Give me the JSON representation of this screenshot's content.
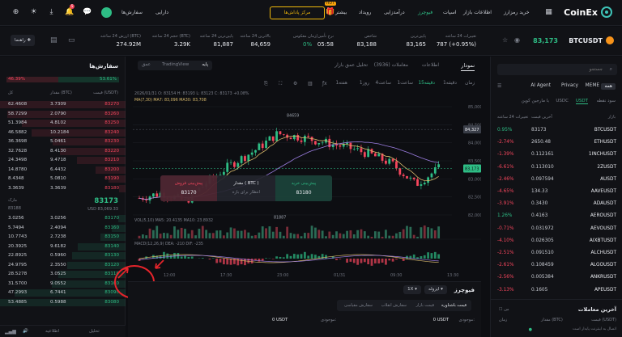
{
  "brand": {
    "name": "CoinEx"
  },
  "topnav": {
    "items": [
      "خرید رمزارز",
      "اطلاعات بازار",
      "اسپات",
      "فیوچرز",
      "درآمدزایی",
      "رویداد",
      "بیشتر"
    ],
    "hot_badge": "HOT",
    "gift_label": "مرکز پاداش‌ها",
    "assets": "دارایی",
    "orders": "سفارش‌ها",
    "notif_count": "5"
  },
  "ticker": {
    "pair": "BTCUSDT",
    "price": "83,173",
    "change_label": "تغییرات 24 ساعته",
    "change_value": "787 (+0.95%)",
    "low_label": "پایین‌ترین",
    "low_value": "83,165",
    "index_label": "شاخص",
    "index_value": "83,188",
    "funding_label": "نرخ تأمین/زمان معکوس",
    "funding_rate": "0%",
    "funding_time": "05:58",
    "high_label": "بالاترین 24 ساعته",
    "high_value": "84,659",
    "low24_label": "پایین‌ترین 24 ساعته",
    "low24_value": "81,887",
    "vol_label": "حجم 24 ساعته (BTC)",
    "vol_value": "3.29K",
    "amount_label": "ارزش 24 ساعته (BTC)",
    "amount_value": "274.92M",
    "guide_label": "راهنما"
  },
  "orderbook": {
    "title": "سفارش‌ها",
    "depth_buy": "53.61%",
    "depth_sell": "46.39%",
    "col_price": "قیمت (USDT)",
    "col_amount": "مقدار (BTC)",
    "col_total": "کل",
    "asks": [
      [
        "83270",
        "3.7309",
        "62.4608"
      ],
      [
        "83260",
        "2.0790",
        "58.7299"
      ],
      [
        "83250",
        "4.8102",
        "51.3984"
      ],
      [
        "83240",
        "10.2184",
        "46.5882"
      ],
      [
        "83230",
        "5.0461",
        "36.3698"
      ],
      [
        "83220",
        "8.4130",
        "32.7628"
      ],
      [
        "83210",
        "9.4718",
        "24.3498"
      ],
      [
        "83200",
        "6.4432",
        "14.8780"
      ],
      [
        "83190",
        "5.0810",
        "8.4348"
      ],
      [
        "83180",
        "3.3639",
        "3.3639"
      ]
    ],
    "mid_price": "83173",
    "mid_usd": "USD 83,069.33",
    "mark_label": "مارک",
    "mark_value": "83188",
    "bids": [
      [
        "83170",
        "3.0256",
        "3.0256"
      ],
      [
        "83160",
        "2.4094",
        "5.7494"
      ],
      [
        "83150",
        "2.7238",
        "10.7743"
      ],
      [
        "83140",
        "9.6182",
        "20.3925"
      ],
      [
        "83130",
        "0.5960",
        "22.8925"
      ],
      [
        "83120",
        "2.3550",
        "24.9795"
      ],
      [
        "83110",
        "3.0525",
        "28.5278"
      ],
      [
        "83100",
        "9.0552",
        "31.5700"
      ],
      [
        "83090",
        "6.7441",
        "47.2993"
      ],
      [
        "83080",
        "0.5988",
        "53.4885"
      ]
    ]
  },
  "chart": {
    "tabs": {
      "price_chart": "نمودار",
      "info": "اطلاعات",
      "trades_label": "معاملات (3936)",
      "depth": "تحلیل عمق بازار"
    },
    "modes": {
      "original": "پایه",
      "tradingview": "TradingView",
      "depth": "عمق"
    },
    "intervals": [
      "زمان",
      "1دقیقه",
      "15دقیقه",
      "1ساعت",
      "4ساعت",
      "1روز",
      "1هفته"
    ],
    "ohlc_line": "2026/01/31 O: 83154  H: 83193  L: 83123  C: 83173  +0.08%",
    "ma_line": "MA(7,30)  MA7: 83,096  MA30: 83,708",
    "vol_line": "VOL(5,10)  MA5: 20.4135  MA10: 23.8932",
    "macd_line": "MACD(12,26,9)  DEA: -210  DIF: -235",
    "high_marker": "84659",
    "low_marker": "81887",
    "y_labels": [
      "85,000",
      "84,500",
      "84,000",
      "83,500",
      "83,000",
      "82,500",
      "82,000"
    ],
    "price_tag": "83,173",
    "price_tag2": "84,327",
    "x_labels": [
      "12:00",
      "17:30",
      "23:00",
      "01/31",
      "09:30",
      "13:30"
    ],
    "popup": {
      "buy_title": "پیش‌بینی فروش",
      "buy_value": "83170",
      "mid_title": "مقدار ( BTC )",
      "mid_sub": "انتظار برای بازه",
      "sell_title": "پیش‌بینی خرید",
      "sell_value": "83180"
    }
  },
  "chart_data": {
    "type": "line",
    "title": "",
    "xlabel": "",
    "ylabel": "",
    "ylim": [
      81800,
      85000
    ],
    "x": [
      "12:00",
      "17:30",
      "23:00",
      "01/31",
      "09:30",
      "13:30"
    ],
    "series": [
      {
        "values": [
          82300,
          82450,
          82200,
          82800,
          83300,
          83700,
          84200,
          84100,
          83950,
          83800,
          83600,
          83300,
          82700,
          83173
        ]
      }
    ]
  },
  "futures": {
    "title": "فیوچرز",
    "leverage": "1X",
    "margin_mode": "ایزوله",
    "tabs": [
      "قیمت باشناوره",
      "قیمت بازار",
      "سفارش انقلاب",
      "سفارش مقیاسی"
    ],
    "available_label": "موجودی:",
    "available_value": "0 USDT",
    "available_label2": "موجودی:",
    "available_value2": "0 USDT"
  },
  "markets": {
    "search_placeholder": "جستجو",
    "categories": [
      "همه",
      "MEME",
      "Privacy",
      "AI Agent"
    ],
    "quote_tabs": [
      "USDT",
      "USDC",
      "با مارجین کوین"
    ],
    "sub_tab": "سود نقطه",
    "col_pair": "بازار",
    "col_price": "آخرین قیمت",
    "col_change": "تغییرات 24 ساعته",
    "rows": [
      [
        "BTCUSDT",
        "83173",
        "0.95%"
      ],
      [
        "ETHUSDT",
        "2650.48",
        "-2.74%"
      ],
      [
        "1INCHUSDT",
        "0.112161",
        "-1.39%"
      ],
      [
        "2ZUSDT",
        "0.113010",
        "-6.61%"
      ],
      [
        "AUSDT",
        "0.097594",
        "-2.46%"
      ],
      [
        "AAVEUSDT",
        "134.33",
        "-4.65%"
      ],
      [
        "ADAUSDT",
        "0.3430",
        "-3.91%"
      ],
      [
        "AEROUSDT",
        "0.4163",
        "1.26%"
      ],
      [
        "AEVOUSDT",
        "0.031972",
        "-0.71%"
      ],
      [
        "AIXBTUSDT",
        "0.026305",
        "-4.10%"
      ],
      [
        "ALCHUSDT",
        "0.091510",
        "-2.51%"
      ],
      [
        "ALGOUSDT",
        "0.108459",
        "-2.61%"
      ],
      [
        "ANKRUSDT",
        "0.005384",
        "-2.56%"
      ],
      [
        "APEUSDT",
        "0.1605",
        "-3.13%"
      ]
    ],
    "recent_title": "آخرین معاملات",
    "recent_col_price": "قیمت (USDT)",
    "recent_col_amount": "مقدار (BTC)",
    "recent_col_time": "زمان",
    "recent_toggle": "من",
    "recent_note": "اتصال به اینترنت پایدار است"
  },
  "statusbar": {
    "left": "اطلاعیه",
    "right": "تحلیل"
  }
}
